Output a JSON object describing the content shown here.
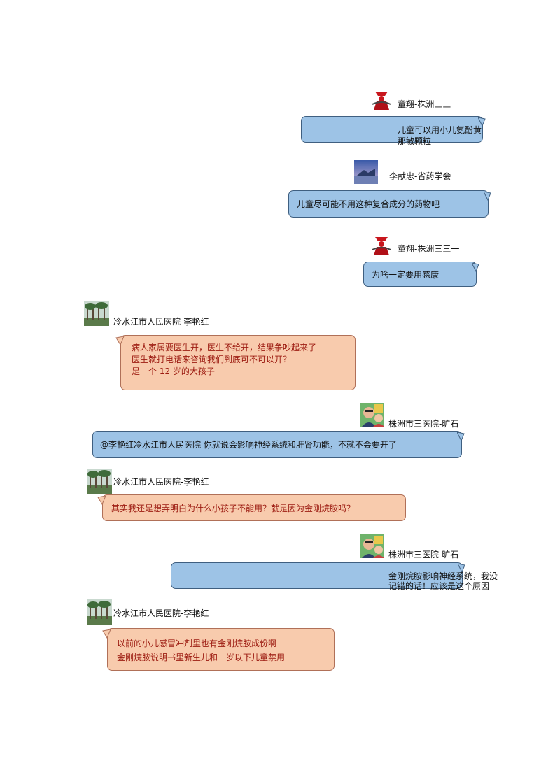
{
  "messages": [
    {
      "sender": "童翔-株洲三三一",
      "lines": [
        "儿童可以用小儿氨酚黄",
        "那敏颗粒"
      ],
      "side": "right",
      "color": "blue",
      "avatar": "red-figure-avatar"
    },
    {
      "sender": "李献忠-省药学会",
      "lines": [
        "儿童尽可能不用这种复合成分的药物吧"
      ],
      "side": "right",
      "color": "blue",
      "avatar": "lake-mountain-avatar"
    },
    {
      "sender": "童翔-株洲三三一",
      "lines": [
        "为啥一定要用感康"
      ],
      "side": "right",
      "color": "blue",
      "avatar": "red-figure-avatar"
    },
    {
      "sender": "冷水江市人民医院-李艳红",
      "lines": [
        "病人家属要医生开，医生不给开，结果争吵起来了",
        "医生就打电话来咨询我们到底可不可以开？",
        "是一个 12 岁的大孩子"
      ],
      "side": "left",
      "color": "orange",
      "avatar": "trees-avatar"
    },
    {
      "sender": "株洲市三医院-旷石",
      "lines": [
        "@李艳红冷水江市人民医院  你就说会影响神经系统和肝肾功能，不就不会要开了"
      ],
      "side": "right",
      "color": "blue",
      "avatar": "family-photo-avatar"
    },
    {
      "sender": "冷水江市人民医院-李艳红",
      "lines": [
        "其实我还是想弄明白为什么小孩子不能用？就是因为金刚烷胺吗？"
      ],
      "side": "left",
      "color": "orange",
      "avatar": "trees-avatar"
    },
    {
      "sender": "株洲市三医院-旷石",
      "lines": [
        "金刚烷胺影响神经系统，我没",
        "记错的话！应该是这个原因"
      ],
      "side": "right",
      "color": "blue",
      "avatar": "family-photo-avatar"
    },
    {
      "sender": "冷水江市人民医院-李艳红",
      "lines": [
        "以前的小儿感冒冲剂里也有金刚烷胺成份啊",
        "金刚烷胺说明书里新生儿和一岁以下儿童禁用"
      ],
      "side": "left",
      "color": "orange",
      "avatar": "trees-avatar"
    }
  ],
  "colors": {
    "blue_bubble": "#9dc3e6",
    "orange_bubble": "#f8cbad",
    "red_text": "#9c1a10"
  }
}
